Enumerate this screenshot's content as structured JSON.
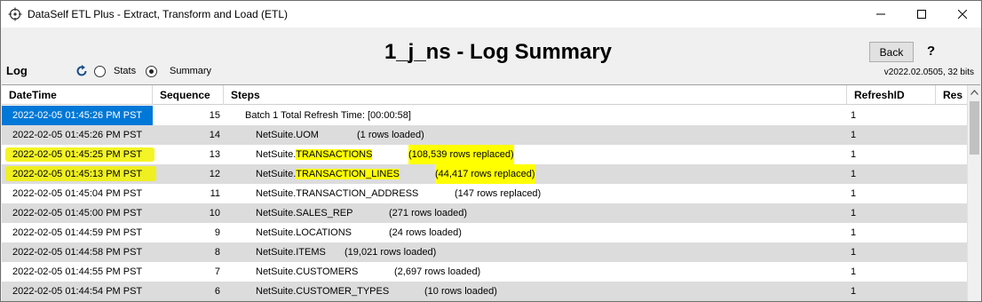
{
  "window": {
    "title": "DataSelf ETL Plus - Extract, Transform and Load (ETL)"
  },
  "header": {
    "log_label": "Log",
    "radio_stats_label": "Stats",
    "radio_summary_label": "Summary",
    "selected_view": "Summary",
    "page_title": "1_j_ns - Log Summary",
    "back_label": "Back",
    "help_label": "?",
    "version": "v2022.02.0505, 32 bits"
  },
  "grid": {
    "columns": [
      "DateTime",
      "Sequence",
      "Steps",
      "RefreshID",
      "Res"
    ],
    "rows": [
      {
        "datetime": "2022-02-05   01:45:26 PM   PST",
        "sequence": "15",
        "step_name": "Batch   1 Total Refresh Time: [00:00:58]",
        "step_info": "",
        "refresh_id": "1",
        "selected": true
      },
      {
        "datetime": "2022-02-05   01:45:26 PM   PST",
        "sequence": "14",
        "step_name": "NetSuite.UOM",
        "step_info": "(1 rows loaded)",
        "refresh_id": "1"
      },
      {
        "datetime": "2022-02-05   01:45:25 PM   PST",
        "sequence": "13",
        "step_prefix": "NetSuite.",
        "step_table": "TRANSACTIONS",
        "step_info": "(108,539 rows replaced)",
        "refresh_id": "1",
        "highlighted": true
      },
      {
        "datetime": "2022-02-05   01:45:13 PM   PST",
        "sequence": "12",
        "step_prefix": "NetSuite.",
        "step_table": "TRANSACTION_LINES",
        "step_info": "(44,417 rows replaced)",
        "refresh_id": "1",
        "highlighted": true
      },
      {
        "datetime": "2022-02-05   01:45:04 PM   PST",
        "sequence": "11",
        "step_name": "NetSuite.TRANSACTION_ADDRESS",
        "step_info": "(147 rows replaced)",
        "refresh_id": "1"
      },
      {
        "datetime": "2022-02-05   01:45:00 PM   PST",
        "sequence": "10",
        "step_name": "NetSuite.SALES_REP",
        "step_info": "(271 rows loaded)",
        "refresh_id": "1"
      },
      {
        "datetime": "2022-02-05   01:44:59 PM   PST",
        "sequence": "9",
        "step_name": "NetSuite.LOCATIONS",
        "step_info": "(24 rows loaded)",
        "refresh_id": "1"
      },
      {
        "datetime": "2022-02-05   01:44:58 PM   PST",
        "sequence": "8",
        "step_name": "NetSuite.ITEMS",
        "step_info": "(19,021 rows loaded)",
        "refresh_id": "1"
      },
      {
        "datetime": "2022-02-05   01:44:55 PM   PST",
        "sequence": "7",
        "step_name": "NetSuite.CUSTOMERS",
        "step_info": "(2,697 rows loaded)",
        "refresh_id": "1"
      },
      {
        "datetime": "2022-02-05   01:44:54 PM   PST",
        "sequence": "6",
        "step_name": "NetSuite.CUSTOMER_TYPES",
        "step_info": "(10 rows loaded)",
        "refresh_id": "1"
      }
    ]
  },
  "colors": {
    "selection": "#0078d7",
    "highlight": "#ffff00",
    "alt_row": "#dcdcdc"
  }
}
